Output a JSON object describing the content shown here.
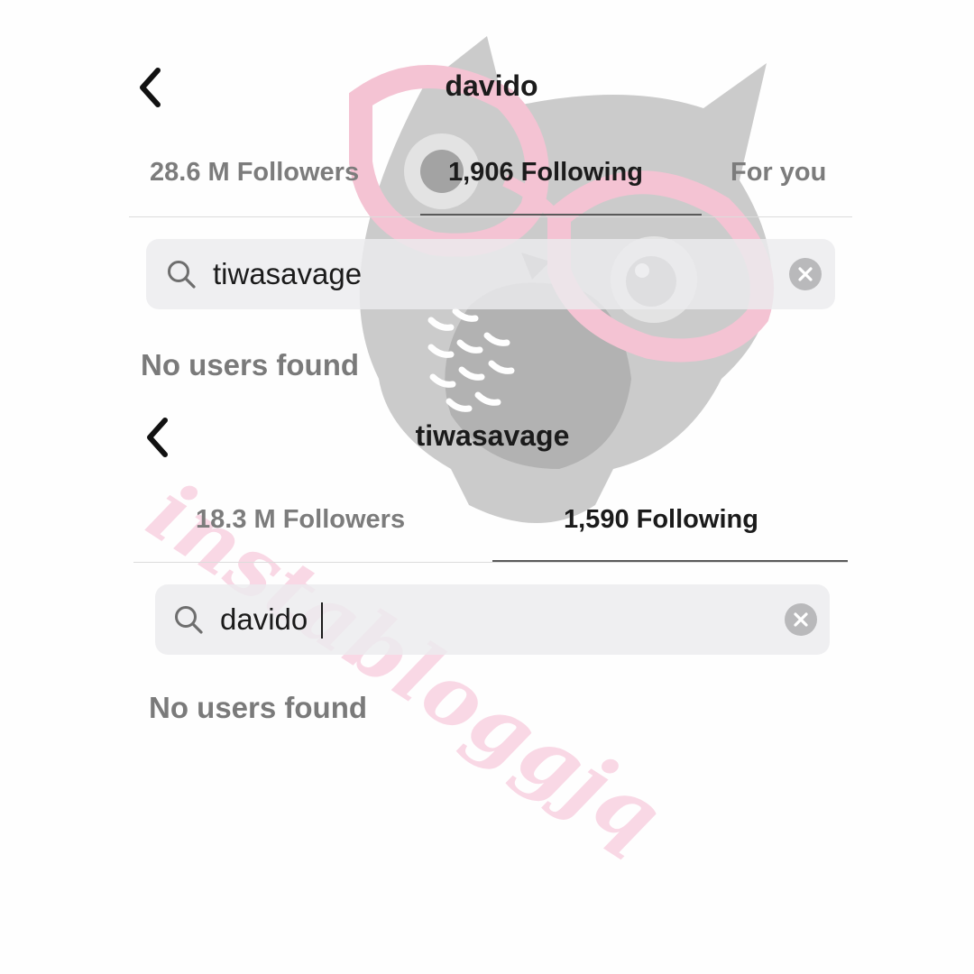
{
  "watermark": {
    "text": "instabloggjq",
    "logo_icon": "owl-with-glasses-icon"
  },
  "screens": [
    {
      "title": "davido",
      "tabs": [
        {
          "label": "28.6 M Followers",
          "active": false
        },
        {
          "label": "1,906 Following",
          "active": true
        },
        {
          "label": "For you",
          "active": false
        }
      ],
      "search": {
        "value": "tiwasavage",
        "placeholder": "Search"
      },
      "empty_message": "No users found"
    },
    {
      "title": "tiwasavage",
      "tabs": [
        {
          "label": "18.3 M Followers",
          "active": false
        },
        {
          "label": "1,590 Following",
          "active": true
        }
      ],
      "search": {
        "value": "davido",
        "placeholder": "Search"
      },
      "empty_message": "No users found"
    }
  ],
  "colors": {
    "text_primary": "#1b1b1b",
    "text_secondary": "#7c7c7c",
    "search_bg": "#ececee",
    "watermark_pink": "#ee78a5"
  }
}
